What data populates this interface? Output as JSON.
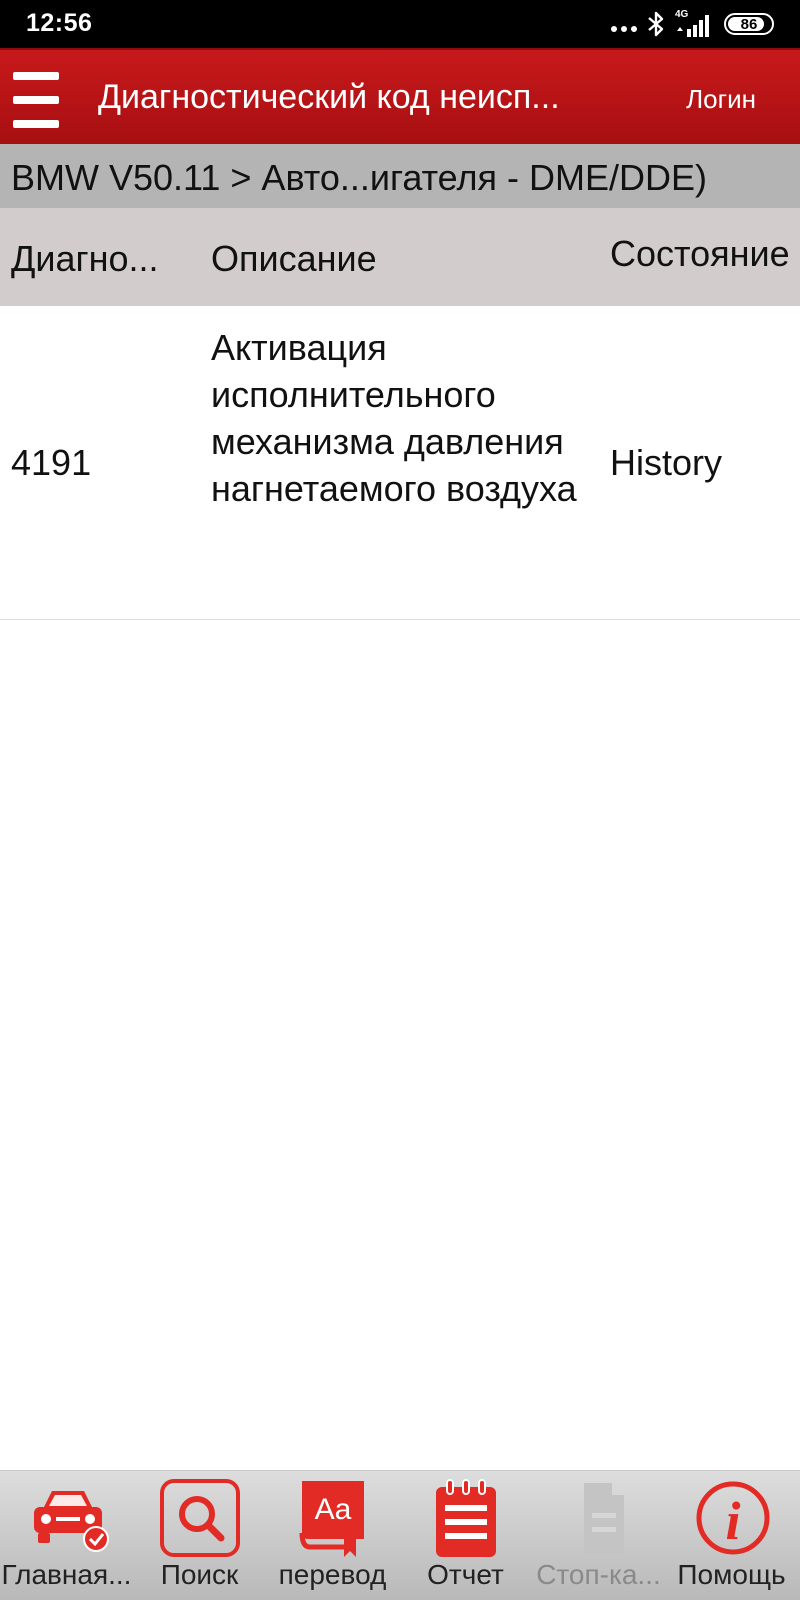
{
  "status_bar": {
    "time": "12:56",
    "network": "4G",
    "battery": "86",
    "battery_level": 0.86,
    "icons": [
      "more-dots-icon",
      "bluetooth-icon",
      "signal-icon",
      "battery-icon"
    ]
  },
  "header": {
    "title": "Диагностический код неисп...",
    "login_label": "Логин",
    "color": "#b51416"
  },
  "breadcrumb": {
    "text": "BMW V50.11 > Авто...игателя - DME/DDE)"
  },
  "table": {
    "columns": [
      "Диагно...",
      "Описание",
      "Состояние"
    ],
    "rows": [
      {
        "code": "4191",
        "description": "Активация исполнительного механизма давления нагнетаемого воздуха",
        "status": "History"
      }
    ]
  },
  "toolbar": {
    "items": [
      {
        "label": "Главная...",
        "icon": "car-home-icon",
        "enabled": true
      },
      {
        "label": "Поиск",
        "icon": "search-icon",
        "enabled": true
      },
      {
        "label": "перевод",
        "icon": "translate-book-icon",
        "enabled": true
      },
      {
        "label": "Отчет",
        "icon": "report-notepad-icon",
        "enabled": true
      },
      {
        "label": "Стоп-ка...",
        "icon": "freeze-frame-document-icon",
        "enabled": false
      },
      {
        "label": "Помощь",
        "icon": "info-help-icon",
        "enabled": true
      }
    ],
    "accent_color": "#e12b24"
  }
}
